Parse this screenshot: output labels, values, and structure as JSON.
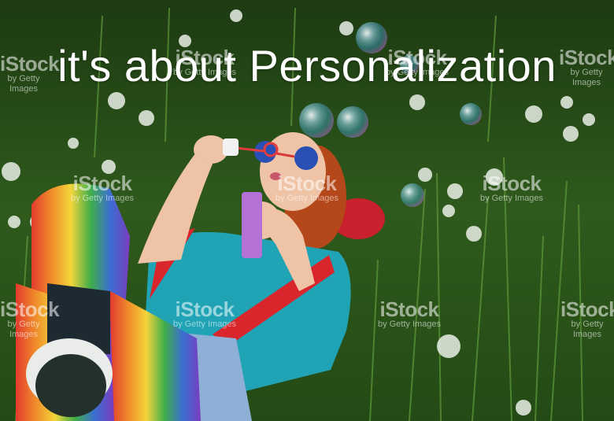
{
  "headline": "it's about Personalization",
  "watermark": {
    "brand": "iStock",
    "credit": "by Getty Images"
  },
  "scene_subject": "woman-blowing-bubbles-in-meadow",
  "colors": {
    "grass": "#2f5a1c",
    "shirt": "#1fa3b5",
    "suspenders": "#d8262c",
    "hair": "#c4541c"
  }
}
